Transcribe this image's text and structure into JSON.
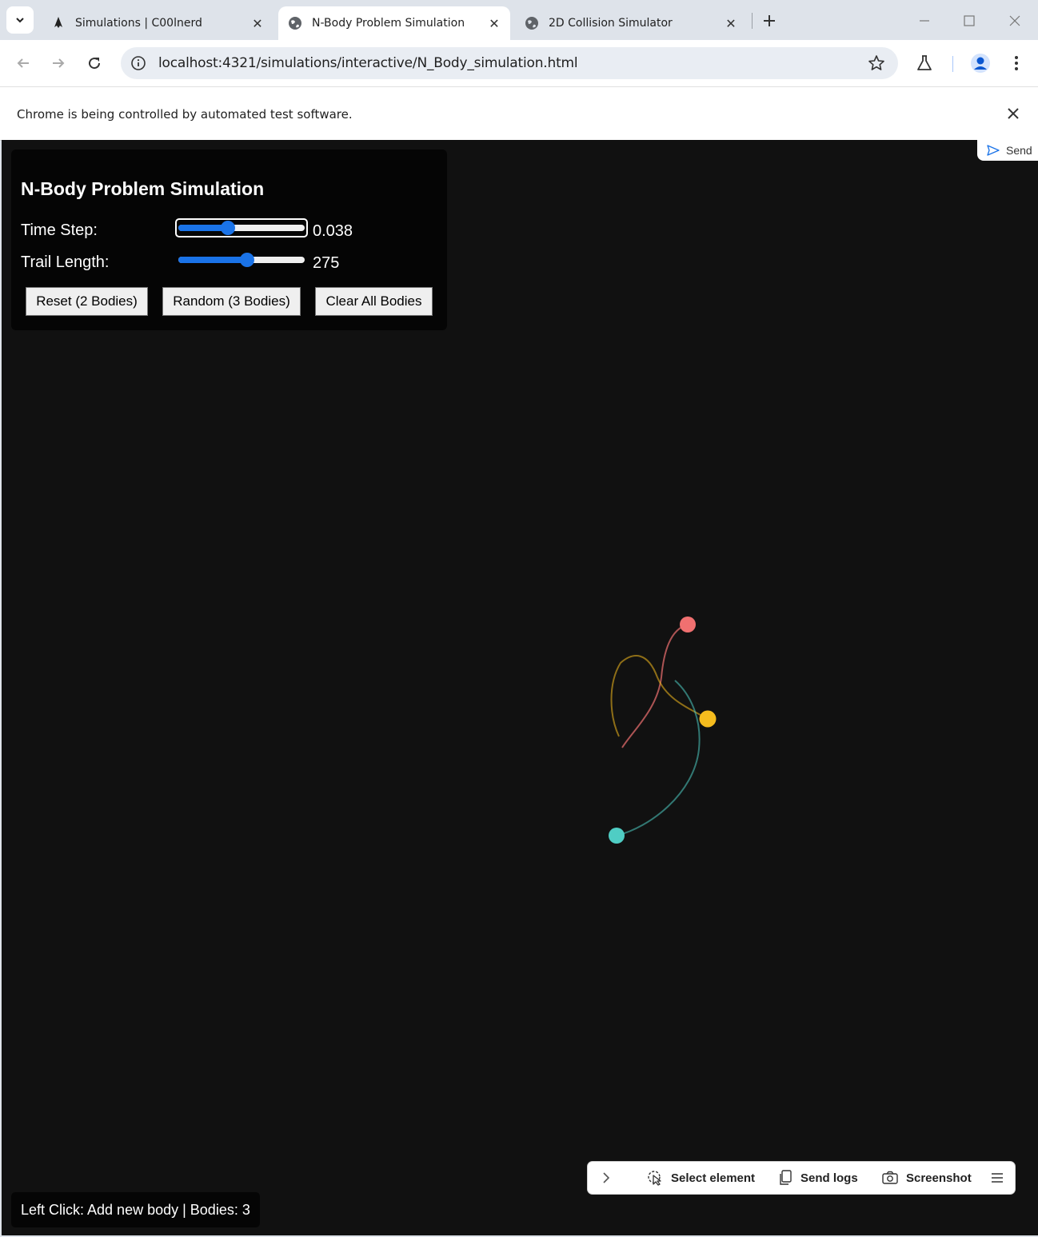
{
  "browser": {
    "tabs": [
      {
        "title": "Simulations | C00lnerd",
        "active": false,
        "icon": "astro-icon"
      },
      {
        "title": "N-Body Problem Simulation",
        "active": true,
        "icon": "globe-icon"
      },
      {
        "title": "2D Collision Simulator",
        "active": false,
        "icon": "globe-icon"
      }
    ],
    "url": "localhost:4321/simulations/interactive/N_Body_simulation.html",
    "infobar_text": "Chrome is being controlled by automated test software."
  },
  "sim": {
    "title": "N-Body Problem Simulation",
    "time_step_label": "Time Step:",
    "time_step_value": "0.038",
    "time_step_fraction": 0.38,
    "trail_length_label": "Trail Length:",
    "trail_length_value": "275",
    "trail_length_fraction": 0.55,
    "buttons": {
      "reset": "Reset (2 Bodies)",
      "random": "Random (3 Bodies)",
      "clear": "Clear All Bodies"
    },
    "status": "Left Click: Add new body | Bodies: 3",
    "bodies": [
      {
        "color": "#f07070"
      },
      {
        "color": "#f5bc1e"
      },
      {
        "color": "#4fcdc4"
      }
    ]
  },
  "overlay": {
    "send_label": "Send",
    "devbar": {
      "select_element": "Select element",
      "send_logs": "Send logs",
      "screenshot": "Screenshot"
    }
  }
}
